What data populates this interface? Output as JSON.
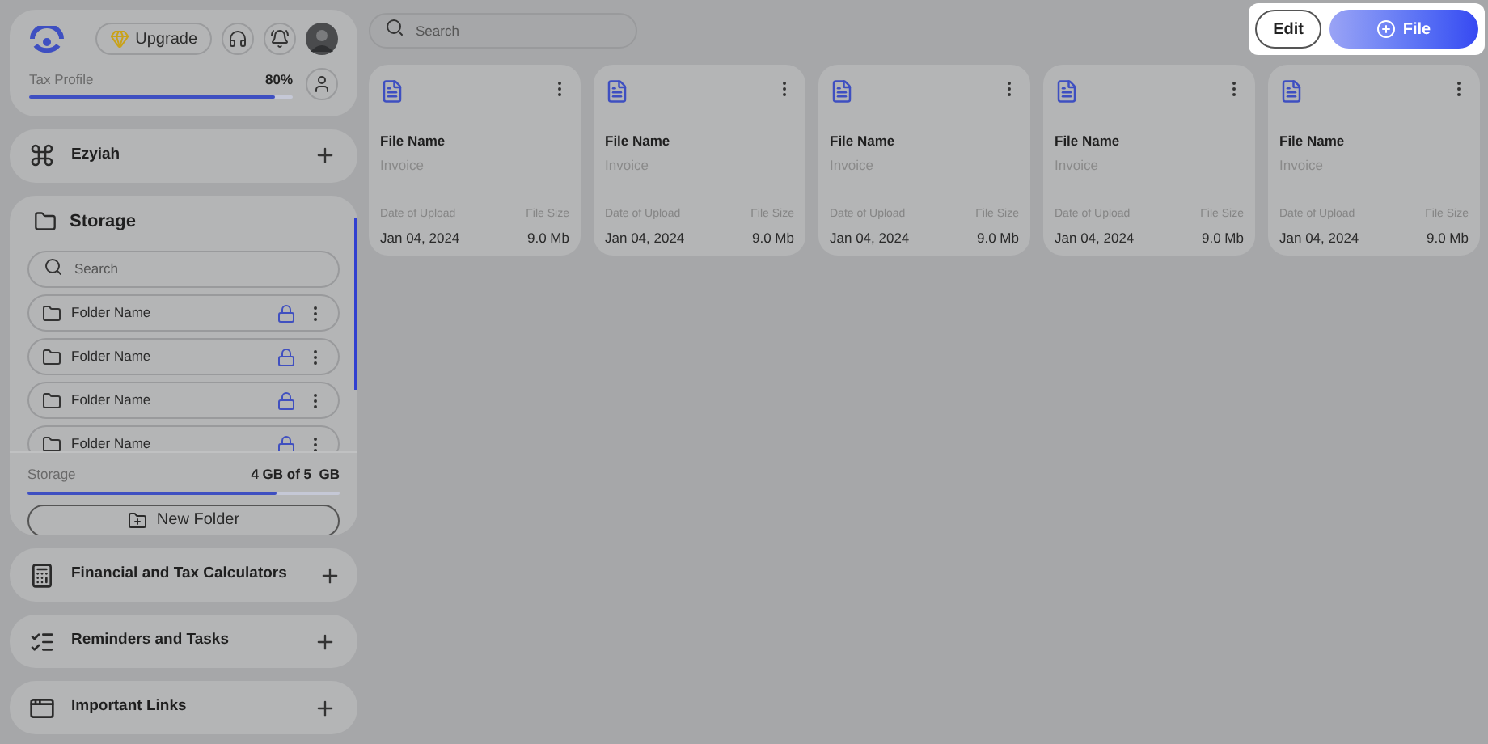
{
  "header": {
    "upgrade": "Upgrade",
    "tax_profile": {
      "label": "Tax Profile",
      "percent": "80%",
      "level": 0.93
    }
  },
  "sections_top": [
    {
      "title": "Ezyiah"
    }
  ],
  "storage": {
    "title": "Storage",
    "search": {
      "placeholder": "Search"
    },
    "folders": [
      {
        "name": "Folder Name",
        "locked": true
      },
      {
        "name": "Folder Name",
        "locked": true
      },
      {
        "name": "Folder Name",
        "locked": true
      },
      {
        "name": "Folder Name",
        "locked": true
      }
    ],
    "usage": {
      "label": "Storage",
      "value": "4 GB of 5  GB",
      "level": 0.8
    },
    "new_folder": "New Folder"
  },
  "sections": [
    {
      "title": "Financial and Tax Calculators"
    },
    {
      "title": "Reminders and Tasks"
    },
    {
      "title": "Important Links"
    }
  ],
  "search": {
    "placeholder": "Search"
  },
  "actions": {
    "edit": "Edit",
    "file": "File"
  },
  "files": [
    {
      "name": "File Name",
      "type": "Invoice",
      "date_label": "Date of Upload",
      "date": "Jan 04, 2024",
      "size_label": "File Size",
      "size": "9.0 Mb"
    },
    {
      "name": "File Name",
      "type": "Invoice",
      "date_label": "Date of Upload",
      "date": "Jan 04, 2024",
      "size_label": "File Size",
      "size": "9.0 Mb"
    },
    {
      "name": "File Name",
      "type": "Invoice",
      "date_label": "Date of Upload",
      "date": "Jan 04, 2024",
      "size_label": "File Size",
      "size": "9.0 Mb"
    },
    {
      "name": "File Name",
      "type": "Invoice",
      "date_label": "Date of Upload",
      "date": "Jan 04, 2024",
      "size_label": "File Size",
      "size": "9.0 Mb"
    },
    {
      "name": "File Name",
      "type": "Invoice",
      "date_label": "Date of Upload",
      "date": "Jan 04, 2024",
      "size_label": "File Size",
      "size": "9.0 Mb"
    }
  ]
}
